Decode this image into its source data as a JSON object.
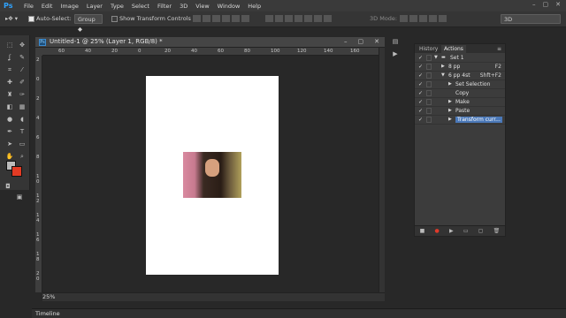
{
  "app": {
    "logo": "Ps"
  },
  "menu": [
    "File",
    "Edit",
    "Image",
    "Layer",
    "Type",
    "Select",
    "Filter",
    "3D",
    "View",
    "Window",
    "Help"
  ],
  "window_controls": [
    "–",
    "▢",
    "✕"
  ],
  "options": {
    "auto_select_label": "Auto-Select:",
    "auto_select_value": "Group",
    "show_transform_label": "Show Transform Controls",
    "mode_label": "3D Mode:",
    "workspace_value": "3D"
  },
  "document": {
    "title": "Untitled-1 @ 25% (Layer 1, RGB/8) *",
    "zoom": "25%",
    "ruler_h": [
      "60",
      "40",
      "20",
      "0",
      "20",
      "40",
      "60",
      "80",
      "100",
      "120",
      "140",
      "160"
    ],
    "ruler_v": [
      "2",
      "0",
      "2",
      "4",
      "6",
      "8",
      "1\n0",
      "1\n2",
      "1\n4",
      "1\n6",
      "1\n8",
      "2\n0"
    ]
  },
  "panel": {
    "tabs": [
      "History",
      "Actions"
    ],
    "active_tab": "Actions",
    "rows": [
      {
        "label": "Set 1",
        "key": "",
        "indent": 1,
        "tri": "▼",
        "kind": "set"
      },
      {
        "label": "8 pp",
        "key": "F2",
        "indent": 2,
        "tri": "▶",
        "kind": "action"
      },
      {
        "label": "6 pp 4st",
        "key": "Shft+F2",
        "indent": 2,
        "tri": "▼",
        "kind": "action"
      },
      {
        "label": "Set Selection",
        "key": "",
        "indent": 3,
        "tri": "▶",
        "kind": "step"
      },
      {
        "label": "Copy",
        "key": "",
        "indent": 3,
        "tri": "",
        "kind": "step"
      },
      {
        "label": "Make",
        "key": "",
        "indent": 3,
        "tri": "▶",
        "kind": "step"
      },
      {
        "label": "Paste",
        "key": "",
        "indent": 3,
        "tri": "▶",
        "kind": "step"
      },
      {
        "label": "Transform curr...",
        "key": "",
        "indent": 3,
        "tri": "▶",
        "kind": "step",
        "selected": true
      }
    ],
    "footer_icons": [
      "stop-icon",
      "record-icon",
      "play-icon",
      "new-set-icon",
      "new-action-icon",
      "delete-icon"
    ]
  },
  "bottom_panel": {
    "timeline_label": "Timeline"
  },
  "colors": {
    "foreground": "#bcbcbc",
    "background": "#e23b24",
    "accent": "#4a78b8"
  }
}
